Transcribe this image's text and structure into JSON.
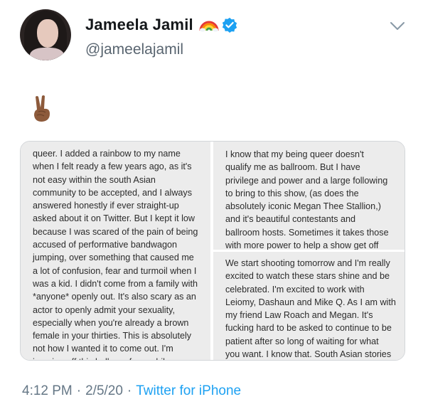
{
  "user": {
    "display_name": "Jameela Jamil",
    "handle": "@jameelajamil"
  },
  "tweet": {
    "emoji": "victory-hand-emoji",
    "timestamp_time": "4:12 PM",
    "timestamp_date": "2/5/20",
    "source": "Twitter for iPhone",
    "separator": "·"
  },
  "media": {
    "left_text": "queer. I added a rainbow to my name\nwhen I felt ready a few years ago, as it's\nnot easy within the south Asian\ncommunity to be accepted, and I always\nanswered honestly if ever straight-up\nasked about it on Twitter. But I kept it low\nbecause I was scared of the pain of being\naccused of performative bandwagon\njumping, over something that caused me\na lot of confusion, fear and turmoil when I\nwas a kid. I didn't come from a family with\n*anyone* openly out. It's also scary as an\nactor to openly admit your sexuality,\nespecially when you're already a brown\nfemale in your thirties. This is absolutely\nnot how I wanted it to come out. I'm\njumping off this hell app for a while",
    "right_top_text": "I know that my being queer doesn't\nqualify me as ballroom. But I have\nprivilege and power and a large following\nto bring to this show, (as does the\nabsolutely iconic Megan Thee Stallion,)\nand it's beautiful contestants and\nballroom hosts. Sometimes it takes those\nwith more power to help a show get off",
    "right_bottom_text": "We start shooting tomorrow and I'm really\nexcited to watch these stars shine and be\ncelebrated. I'm excited to work with\nLeiomy, Dashaun and Mike Q. As I am with\nmy friend Law Roach and Megan. It's\nfucking hard to be asked to continue to be\npatient after so long of waiting for what\nyou want. I know that. South Asian stories"
  },
  "colors": {
    "name": "#14171a",
    "secondary": "#657786",
    "link": "#1da1f2",
    "verified": "#1da1f2"
  }
}
